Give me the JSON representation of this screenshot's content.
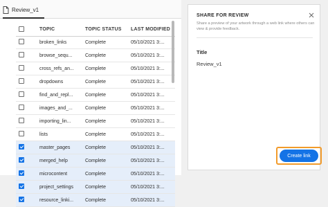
{
  "tab": {
    "label": "Review_v1"
  },
  "table": {
    "headers": {
      "topic": "TOPIC",
      "status": "TOPIC STATUS",
      "modified": "LAST MODIFIED"
    },
    "rows": [
      {
        "topic": "broken_links",
        "status": "Complete",
        "modified": "05/10/2021 3:...",
        "checked": false
      },
      {
        "topic": "browse_sequ...",
        "status": "Complete",
        "modified": "05/10/2021 3:...",
        "checked": false
      },
      {
        "topic": "cross_refs_an...",
        "status": "Complete",
        "modified": "05/10/2021 3:...",
        "checked": false
      },
      {
        "topic": "dropdowns",
        "status": "Complete",
        "modified": "05/10/2021 3:...",
        "checked": false
      },
      {
        "topic": "find_and_repl...",
        "status": "Complete",
        "modified": "05/10/2021 3:...",
        "checked": false
      },
      {
        "topic": "images_and_...",
        "status": "Complete",
        "modified": "05/10/2021 3:...",
        "checked": false
      },
      {
        "topic": "importing_lin...",
        "status": "Complete",
        "modified": "05/10/2021 3:...",
        "checked": false
      },
      {
        "topic": "lists",
        "status": "Complete",
        "modified": "05/10/2021 3:...",
        "checked": false
      },
      {
        "topic": "master_pages",
        "status": "Complete",
        "modified": "05/10/2021 3:...",
        "checked": true
      },
      {
        "topic": "merged_help",
        "status": "Complete",
        "modified": "05/10/2021 3:...",
        "checked": true
      },
      {
        "topic": "microcontent",
        "status": "Complete",
        "modified": "05/10/2021 3:...",
        "checked": true
      },
      {
        "topic": "project_settings",
        "status": "Complete",
        "modified": "05/10/2021 3:...",
        "checked": true
      },
      {
        "topic": "resource_linki...",
        "status": "Complete",
        "modified": "05/10/2021 3:...",
        "checked": true
      }
    ]
  },
  "panel": {
    "title": "SHARE FOR REVIEW",
    "description": "Share a preview of your artwork through a web link where others can view & provide feedback.",
    "field_label": "Title",
    "field_value": "Review_v1",
    "create_button": "Create link"
  },
  "colors": {
    "accent": "#1473e6",
    "highlight": "#f29b2b",
    "selected_row": "#e5eefa"
  },
  "icons": {
    "tab": "file-icon",
    "close": "close-icon"
  }
}
